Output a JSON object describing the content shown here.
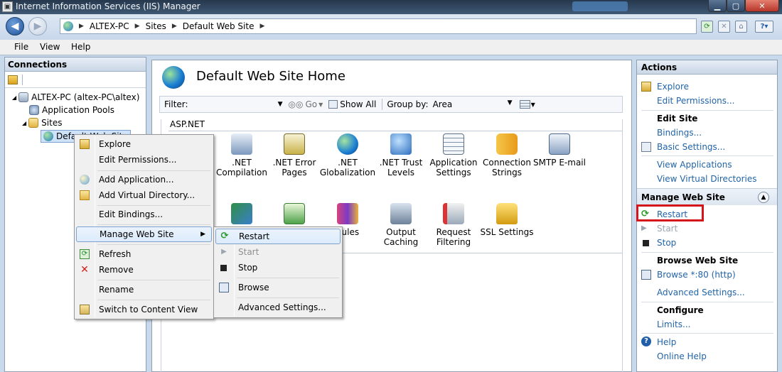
{
  "window": {
    "title": "Internet Information Services (IIS) Manager",
    "colors": {
      "titlebar": "#2f435b",
      "close": "#c9473c",
      "link": "#2164a8",
      "highlight": "#d4151b"
    }
  },
  "breadcrumb": [
    "ALTEX-PC",
    "Sites",
    "Default Web Site"
  ],
  "menu": {
    "file": "File",
    "view": "View",
    "help": "Help"
  },
  "connections": {
    "header": "Connections",
    "tree": {
      "server": "ALTEX-PC (altex-PC\\altex)",
      "app_pools": "Application Pools",
      "sites": "Sites",
      "default_site": "Default Web Site"
    }
  },
  "main": {
    "title": "Default Web Site Home",
    "filter_label": "Filter:",
    "go_label": "Go",
    "show_all_label": "Show All",
    "group_by_label": "Group by:",
    "group_by_value": "Area",
    "group_aspnet": "ASP.NET",
    "features_row1": [
      {
        "line1": ".NET",
        "line2": "Compilation",
        "icon": "compilation-icon"
      },
      {
        "line1": ".NET Error",
        "line2": "Pages",
        "icon": "error-pages-icon"
      },
      {
        "line1": ".NET",
        "line2": "Globalization",
        "icon": "globalization-icon"
      },
      {
        "line1": ".NET Trust",
        "line2": "Levels",
        "icon": "trust-levels-icon"
      },
      {
        "line1": "Application",
        "line2": "Settings",
        "icon": "app-settings-icon"
      },
      {
        "line1": "Connection",
        "line2": "Strings",
        "icon": "connection-strings-icon"
      },
      {
        "line1": "SMTP E-mail",
        "line2": "",
        "icon": "smtp-icon"
      }
    ],
    "features_row2": [
      {
        "line1": "",
        "line2": "",
        "icon": "handler-icon"
      },
      {
        "line1": "",
        "line2": "",
        "icon": "mime-icon"
      },
      {
        "line1": "dules",
        "line2": "",
        "icon": "modules-icon"
      },
      {
        "line1": "Output",
        "line2": "Caching",
        "icon": "output-caching-icon"
      },
      {
        "line1": "Request",
        "line2": "Filtering",
        "icon": "request-filtering-icon"
      },
      {
        "line1": "SSL Settings",
        "line2": "",
        "icon": "ssl-lock-icon"
      }
    ]
  },
  "actions": {
    "header": "Actions",
    "explore": "Explore",
    "edit_permissions": "Edit Permissions...",
    "edit_site": "Edit Site",
    "bindings": "Bindings...",
    "basic_settings": "Basic Settings...",
    "view_applications": "View Applications",
    "view_virtual_dirs": "View Virtual Directories",
    "manage_site": "Manage Web Site",
    "restart": "Restart",
    "start": "Start",
    "stop": "Stop",
    "browse_site": "Browse Web Site",
    "browse_80": "Browse *:80 (http)",
    "advanced_settings": "Advanced Settings...",
    "configure": "Configure",
    "limits": "Limits...",
    "help": "Help",
    "online_help": "Online Help"
  },
  "context_menu": {
    "explore": "Explore",
    "edit_permissions": "Edit Permissions...",
    "add_application": "Add Application...",
    "add_virtual_dir": "Add Virtual Directory...",
    "edit_bindings": "Edit Bindings...",
    "manage_web_site": "Manage Web Site",
    "refresh": "Refresh",
    "remove": "Remove",
    "rename": "Rename",
    "switch_content_view": "Switch to Content View"
  },
  "submenu": {
    "restart": "Restart",
    "start": "Start",
    "stop": "Stop",
    "browse": "Browse",
    "advanced_settings": "Advanced Settings..."
  }
}
